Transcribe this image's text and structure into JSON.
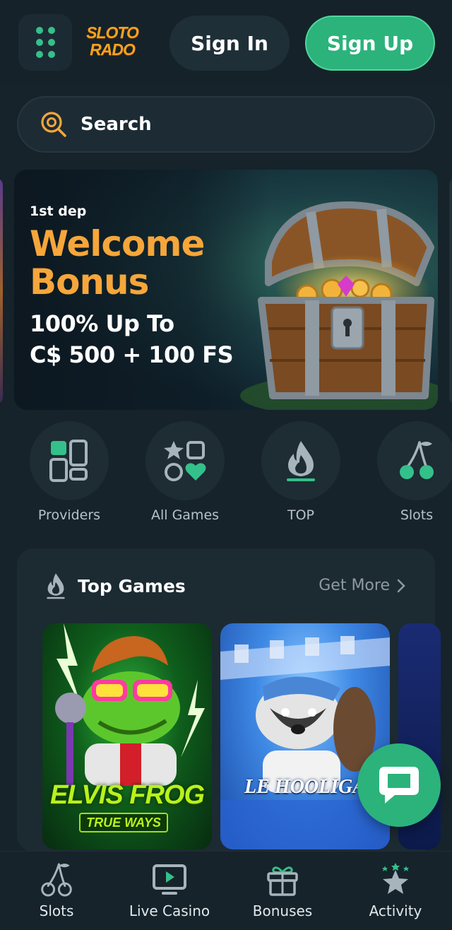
{
  "header": {
    "logo_line1": "SLOTO",
    "logo_line2": "RADO",
    "sign_in": "Sign In",
    "sign_up": "Sign Up"
  },
  "search": {
    "placeholder": "Search"
  },
  "banner": {
    "kicker": "1st dep",
    "title_line1": "Welcome",
    "title_line2": "Bonus",
    "offer_line1": "100% Up To",
    "offer_line2": "C$ 500 + 100 FS"
  },
  "categories": [
    {
      "label": "Providers",
      "icon": "providers-icon"
    },
    {
      "label": "All Games",
      "icon": "all-games-icon"
    },
    {
      "label": "TOP",
      "icon": "flame-icon"
    },
    {
      "label": "Slots",
      "icon": "cherries-icon"
    }
  ],
  "top_games": {
    "title": "Top Games",
    "get_more": "Get More",
    "games": [
      {
        "title": "ELVIS FROG",
        "subtitle": "TRUE WAYS"
      },
      {
        "title": "LE HOOLIGA"
      },
      {
        "title": ""
      }
    ]
  },
  "bottom_nav": [
    {
      "label": "Slots",
      "icon": "cherries-icon"
    },
    {
      "label": "Live Casino",
      "icon": "tv-play-icon"
    },
    {
      "label": "Bonuses",
      "icon": "gift-icon"
    },
    {
      "label": "Activity",
      "icon": "star-icon"
    }
  ],
  "colors": {
    "accent": "#2bb37b",
    "bonus_orange": "#f6a63a",
    "background": "#16232b",
    "card": "#1c2a32"
  }
}
